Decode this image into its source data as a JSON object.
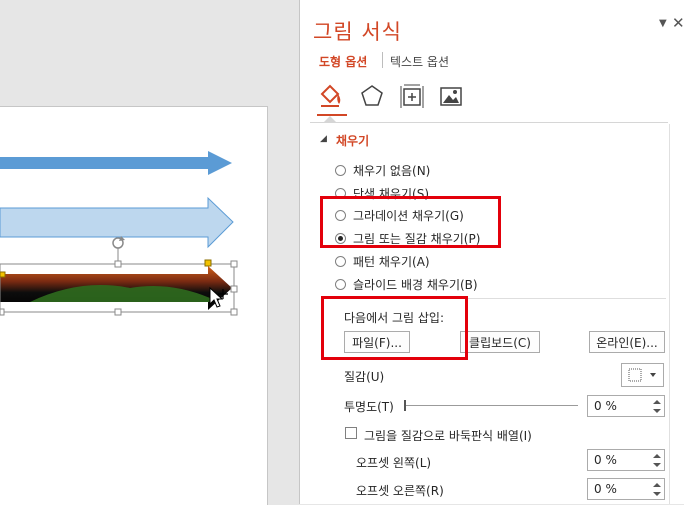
{
  "pane": {
    "title": "그림 서식",
    "tabs": [
      "도형 옵션",
      "텍스트 옵션"
    ],
    "icons": [
      "fill-line-icon",
      "effects-icon",
      "size-properties-icon",
      "picture-icon"
    ],
    "section_title": "채우기",
    "fill_options": [
      {
        "label": "채우기 없음(N)",
        "selected": false
      },
      {
        "label": "단색 채우기(S)",
        "selected": false
      },
      {
        "label": "그라데이션 채우기(G)",
        "selected": false
      },
      {
        "label": "그림 또는 질감 채우기(P)",
        "selected": true
      },
      {
        "label": "패턴 채우기(A)",
        "selected": false
      },
      {
        "label": "슬라이드 배경 채우기(B)",
        "selected": false
      }
    ],
    "insert_from_label": "다음에서 그림 삽입:",
    "buttons": {
      "file": "파일(F)...",
      "clipboard": "클립보드(C)",
      "online": "온라인(E)..."
    },
    "texture_label": "질감(U)",
    "transparency_label": "투명도(T)",
    "transparency_value": "0 %",
    "tile_label": "그림을 질감으로 바둑판식 배열(I)",
    "offset_left_label": "오프셋 왼쪽(L)",
    "offset_left_value": "0 %",
    "offset_right_label": "오프셋 오른쪽(R)",
    "offset_right_value": "0 %"
  },
  "colors": {
    "accent": "#d24726",
    "highlight": "#e3000b",
    "arrow_dark": "#5b9bd5",
    "arrow_light": "#bdd7ee"
  }
}
